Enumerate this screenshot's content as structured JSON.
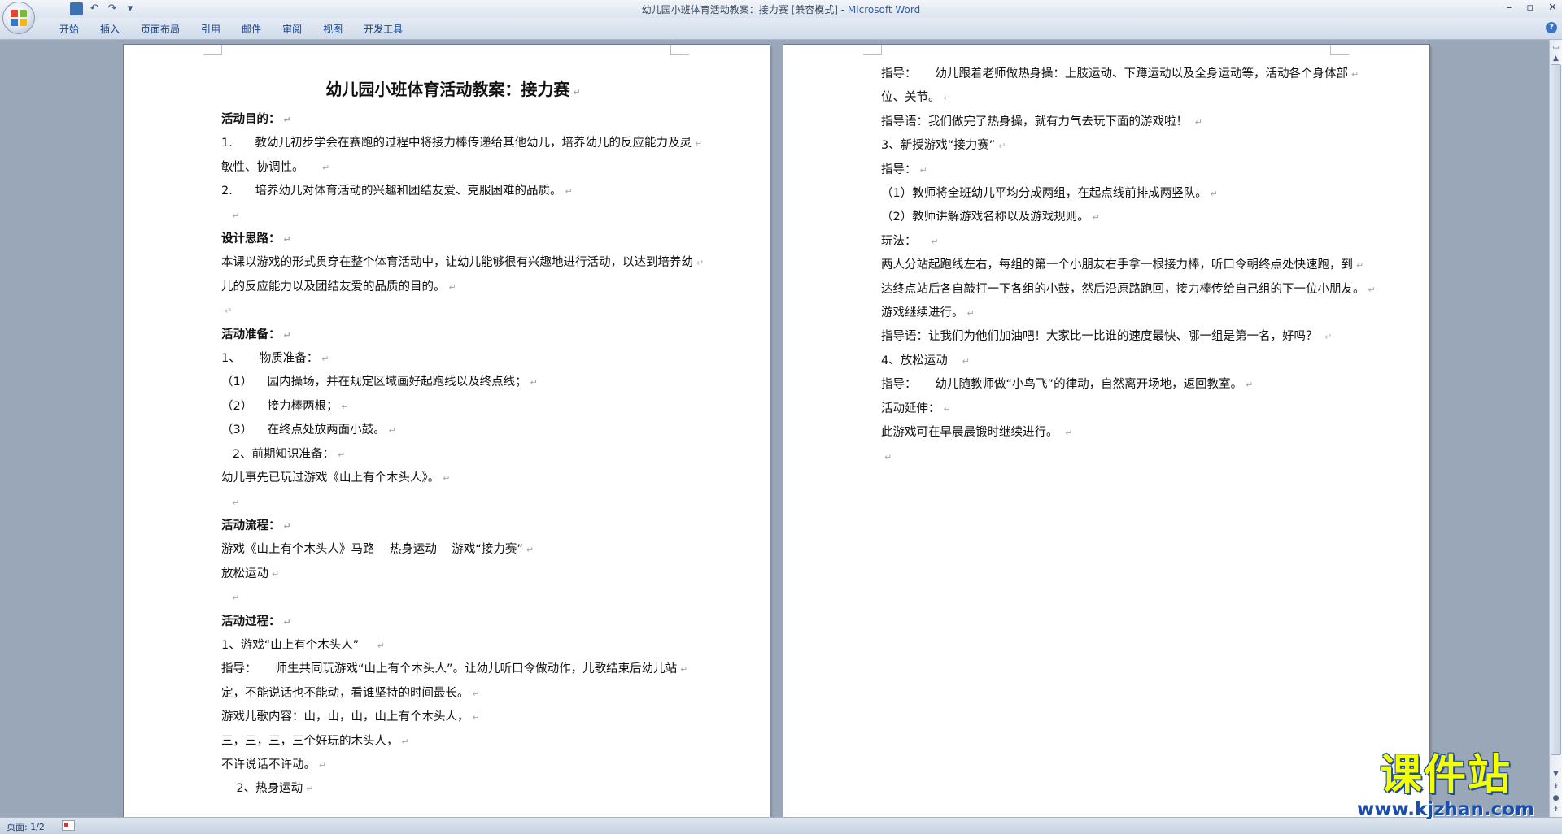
{
  "window": {
    "title": "幼儿园小班体育活动教案：接力赛 [兼容模式] - ",
    "app": "Microsoft Word"
  },
  "quick_access": {
    "menu_glyph": "▾"
  },
  "ribbon": {
    "tabs": [
      "开始",
      "插入",
      "页面布局",
      "引用",
      "邮件",
      "审阅",
      "视图",
      "开发工具"
    ],
    "help": "?"
  },
  "status": {
    "page_count": "页面: 1/2"
  },
  "doc": {
    "title": "幼儿园小班体育活动教案：接力赛",
    "page1": [
      {
        "t": "活动目的：",
        "b": true
      },
      {
        "t": "1.      教幼儿初步学会在赛跑的过程中将接力棒传递给其他幼儿，培养幼儿的反应能力及灵"
      },
      {
        "t": "敏性、协调性。    "
      },
      {
        "t": "2.      培养幼儿对体育活动的兴趣和团结友爱、克服困难的品质。"
      },
      {
        "t": "  "
      },
      {
        "t": "设计思路：",
        "b": true
      },
      {
        "t": "本课以游戏的形式贯穿在整个体育活动中，让幼儿能够很有兴趣地进行活动，以达到培养幼"
      },
      {
        "t": "儿的反应能力以及团结友爱的品质的目的。"
      },
      {
        "t": ""
      },
      {
        "t": "活动准备：",
        "b": true
      },
      {
        "t": "1、     物质准备："
      },
      {
        "t": "（1）    园内操场，并在规定区域画好起跑线以及终点线；"
      },
      {
        "t": "（2）    接力棒两根；"
      },
      {
        "t": "（3）    在终点处放两面小鼓。"
      },
      {
        "t": "   2、前期知识准备："
      },
      {
        "t": "幼儿事先已玩过游戏《山上有个木头人》。"
      },
      {
        "t": "  "
      },
      {
        "t": "活动流程：",
        "b": true
      },
      {
        "t": "游戏《山上有个木头人》马路    热身运动    游戏“接力赛”"
      },
      {
        "t": "放松运动"
      },
      {
        "t": "  "
      },
      {
        "t": "活动过程：",
        "b": true
      },
      {
        "t": "1、游戏“山上有个木头人”    "
      },
      {
        "t": "指导：     师生共同玩游戏“山上有个木头人”。让幼儿听口令做动作，儿歌结束后幼儿站"
      },
      {
        "t": "定，不能说话也不能动，看谁坚持的时间最长。"
      },
      {
        "t": "游戏儿歌内容：山，山，山，山上有个木头人，"
      },
      {
        "t": "三，三，三，三个好玩的木头人，"
      },
      {
        "t": "不许说话不许动。"
      },
      {
        "t": "    2、热身运动"
      }
    ],
    "page2": [
      {
        "t": "指导：     幼儿跟着老师做热身操：上肢运动、下蹲运动以及全身运动等，活动各个身体部"
      },
      {
        "t": "位、关节。"
      },
      {
        "t": "指导语：我们做完了热身操，就有力气去玩下面的游戏啦！ "
      },
      {
        "t": "3、新授游戏“接力赛”"
      },
      {
        "t": "指导："
      },
      {
        "t": "（1）教师将全班幼儿平均分成两组，在起点线前排成两竖队。"
      },
      {
        "t": "（2）教师讲解游戏名称以及游戏规则。"
      },
      {
        "t": "玩法：   "
      },
      {
        "t": "两人分站起跑线左右，每组的第一个小朋友右手拿一根接力棒，听口令朝终点处快速跑，到"
      },
      {
        "t": "达终点站后各自敲打一下各组的小鼓，然后沿原路跑回，接力棒传给自己组的下一位小朋友。"
      },
      {
        "t": "游戏继续进行。"
      },
      {
        "t": "指导语：让我们为他们加油吧！大家比一比谁的速度最快、哪一组是第一名，好吗？ "
      },
      {
        "t": "4、放松运动   "
      },
      {
        "t": "指导：     幼儿随教师做“小鸟飞”的律动，自然离开场地，返回教室。"
      },
      {
        "t": "活动延伸："
      },
      {
        "t": "此游戏可在早晨晨锻时继续进行。 "
      },
      {
        "t": ""
      }
    ],
    "paragraph_mark": "↵"
  },
  "watermark": {
    "logo": "课件站",
    "url": "www.kjzhan.com"
  },
  "colors": {
    "workspace": "#9aa7b8",
    "ribbon_text": "#15428b",
    "watermark_yellow": "#f4ff00",
    "watermark_blue": "#1b4ea8"
  }
}
